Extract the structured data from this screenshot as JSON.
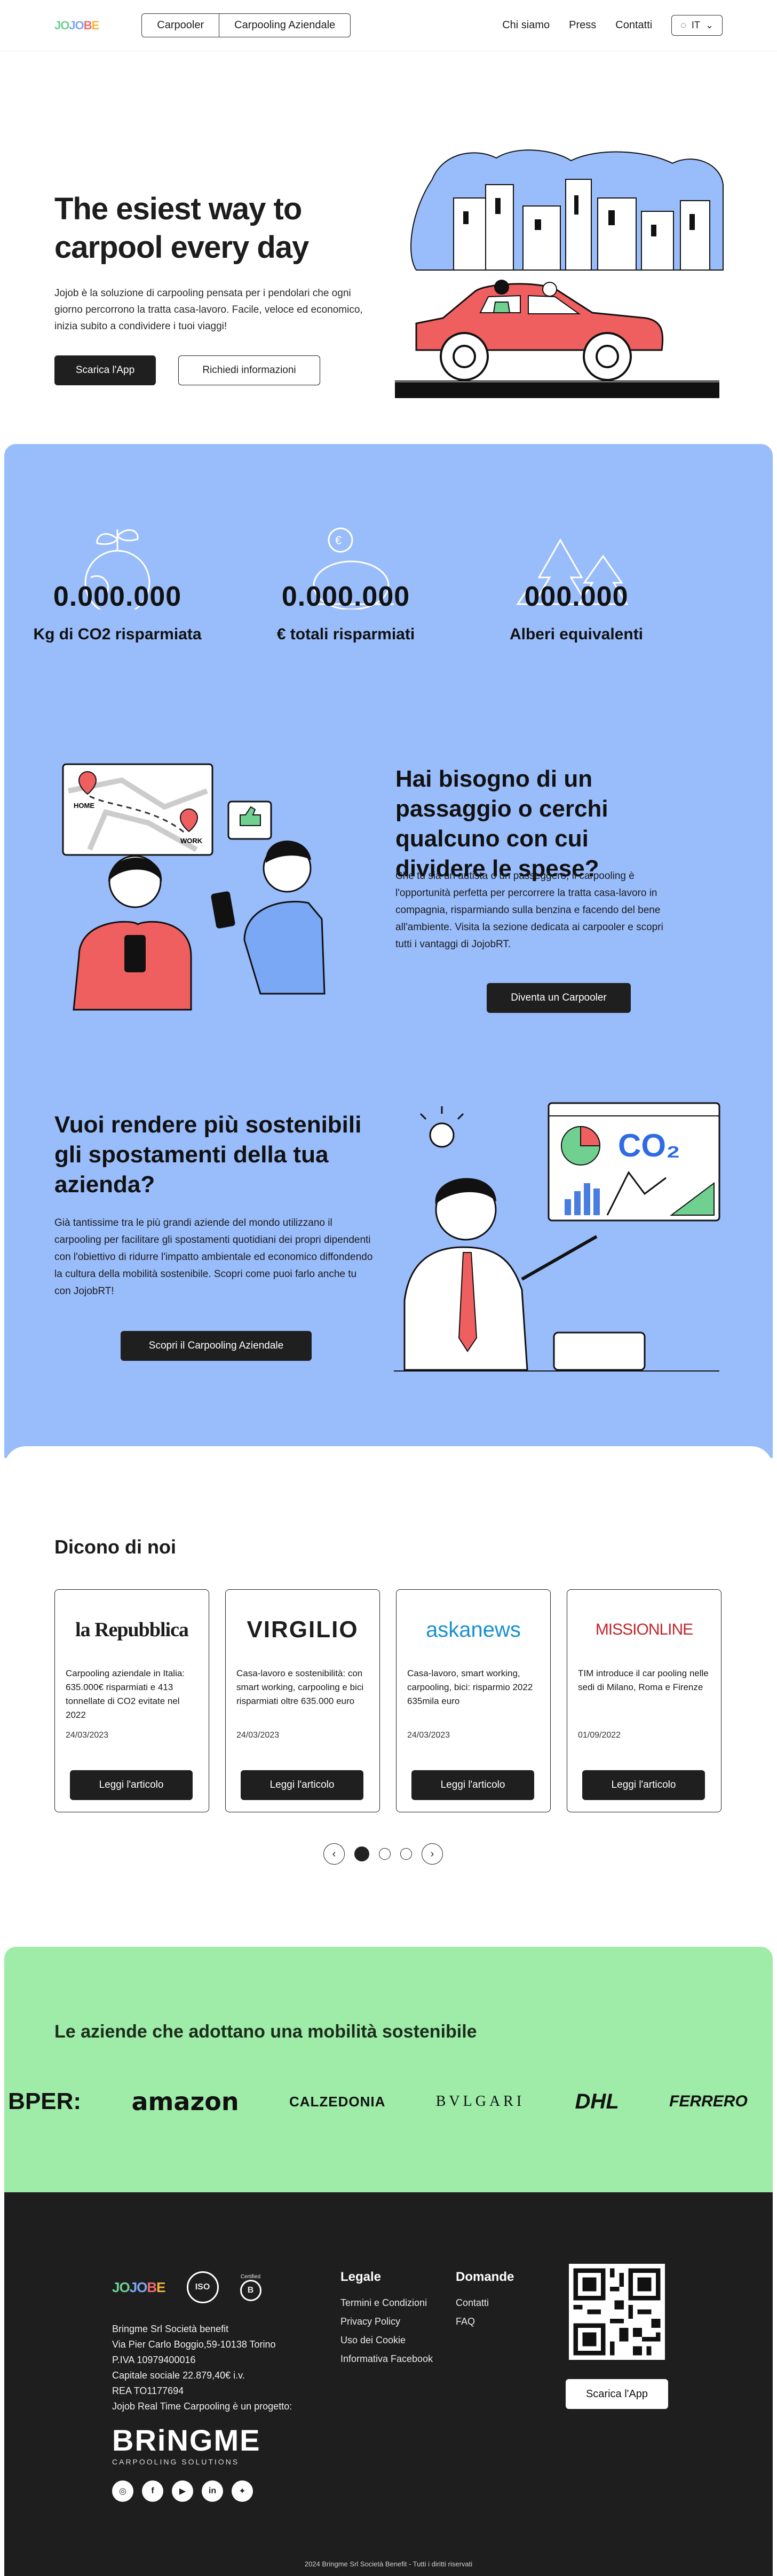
{
  "nav": {
    "logo": [
      "JO",
      "JO",
      "B",
      "E"
    ],
    "tab_carpooler": "Carpooler",
    "tab_aziendale": "Carpooling Aziendale",
    "chi_siamo": "Chi siamo",
    "press": "Press",
    "contatti": "Contatti",
    "lang": "IT"
  },
  "hero": {
    "title": "The esiest way to carpool every day",
    "description": "Jojob è la soluzione di carpooling pensata per i pendolari che ogni giorno percorrono la tratta casa-lavoro. Facile, veloce ed economico, inizia subito a condividere i tuoi viaggi!",
    "btn_app": "Scarica l'App",
    "btn_info": "Richiedi informazioni"
  },
  "stats": [
    {
      "value": "0.000.000",
      "label": "Kg di CO2 risparmiata"
    },
    {
      "value": "0.000.000",
      "label": "€ totali risparmiati"
    },
    {
      "value": "000.000",
      "label": "Alberi equivalenti"
    }
  ],
  "passaggio": {
    "title": "Hai bisogno di un passaggio o cerchi qualcuno con cui dividere le spese?",
    "text": "Che tu sia un autista o un passeggero, il carpooling è l'opportunità perfetta per percorrere la tratta casa-lavoro in compagnia, risparmiando sulla benzina e facendo del bene all'ambiente. Visita la sezione dedicata ai carpooler e scopri tutti i vantaggi di JojobRT.",
    "button": "Diventa un Carpooler",
    "map_home": "HOME",
    "map_work": "WORK"
  },
  "azienda": {
    "title": "Vuoi rendere più sostenibili gli spostamenti della tua azienda?",
    "text": "Già tantissime tra le più grandi aziende del mondo utilizzano il carpooling per facilitare gli spostamenti quotidiani dei propri dipendenti con l'obiettivo di ridurre l'impatto ambientale ed economico diffondendo la cultura della mobilità sostenibile. Scopri come puoi farlo anche tu con JojobRT!",
    "button": "Scopri il Carpooling Aziendale",
    "chart_co2": "CO₂"
  },
  "dicono": {
    "title": "Dicono di noi",
    "cards": [
      {
        "source": "la Repubblica",
        "text": "Carpooling aziendale in Italia: 635.000€ risparmiati e 413 tonnellate di CO2 evitate nel 2022",
        "date": "24/03/2023",
        "button": "Leggi l'articolo"
      },
      {
        "source": "VIRGILIO",
        "text": "Casa-lavoro e sostenibilità: con smart working, carpooling e bici risparmiati oltre 635.000 euro",
        "date": "24/03/2023",
        "button": "Leggi l'articolo"
      },
      {
        "source": "askanews",
        "text": "Casa-lavoro, smart working, carpooling, bici: risparmio 2022 635mila euro",
        "date": "24/03/2023",
        "button": "Leggi l'articolo"
      },
      {
        "source": "MISSIONLINE",
        "text": "TIM introduce il car pooling nelle sedi di Milano, Roma e Firenze",
        "date": "01/09/2022",
        "button": "Leggi l'articolo"
      }
    ],
    "prev": "‹",
    "next": "›"
  },
  "aziende": {
    "title": "Le aziende che adottano una mobilità sostenibile",
    "brands": [
      "BPER:",
      "amazon",
      "CALZEDONIA",
      "BVLGARI",
      "DHL",
      "FERRERO"
    ]
  },
  "footer": {
    "logo": [
      "JO",
      "JO",
      "B",
      "E"
    ],
    "badge_iso": "ISO",
    "badge_bcorp": "B",
    "badge_certified": "Certified",
    "company_lines": [
      "Bringme Srl Società benefit",
      "Via Pier Carlo Boggio,59-10138 Torino",
      "P.IVA 10979400016",
      "Capitale sociale 22.879,40€ i.v.",
      "REA TO1177694",
      "Jojob Real Time Carpooling è un progetto:"
    ],
    "bringme": "BRiNGME",
    "bringme_sub": "CARPOOLING SOLUTIONS",
    "legale_title": "Legale",
    "legale_links": [
      "Termini e Condizioni",
      "Privacy Policy",
      "Uso dei Cookie",
      "Informativa Facebook"
    ],
    "domande_title": "Domande",
    "domande_links": [
      "Contatti",
      "FAQ"
    ],
    "app_button": "Scarica l'App",
    "copyright": "2024 Bringme Srl Società Benefit - Tutti i diritti riservati"
  },
  "colors": {
    "blue": "#99bcfb",
    "green": "#9eeca8",
    "dark": "#1e1e1e",
    "red_car": "#ef5f5f"
  }
}
